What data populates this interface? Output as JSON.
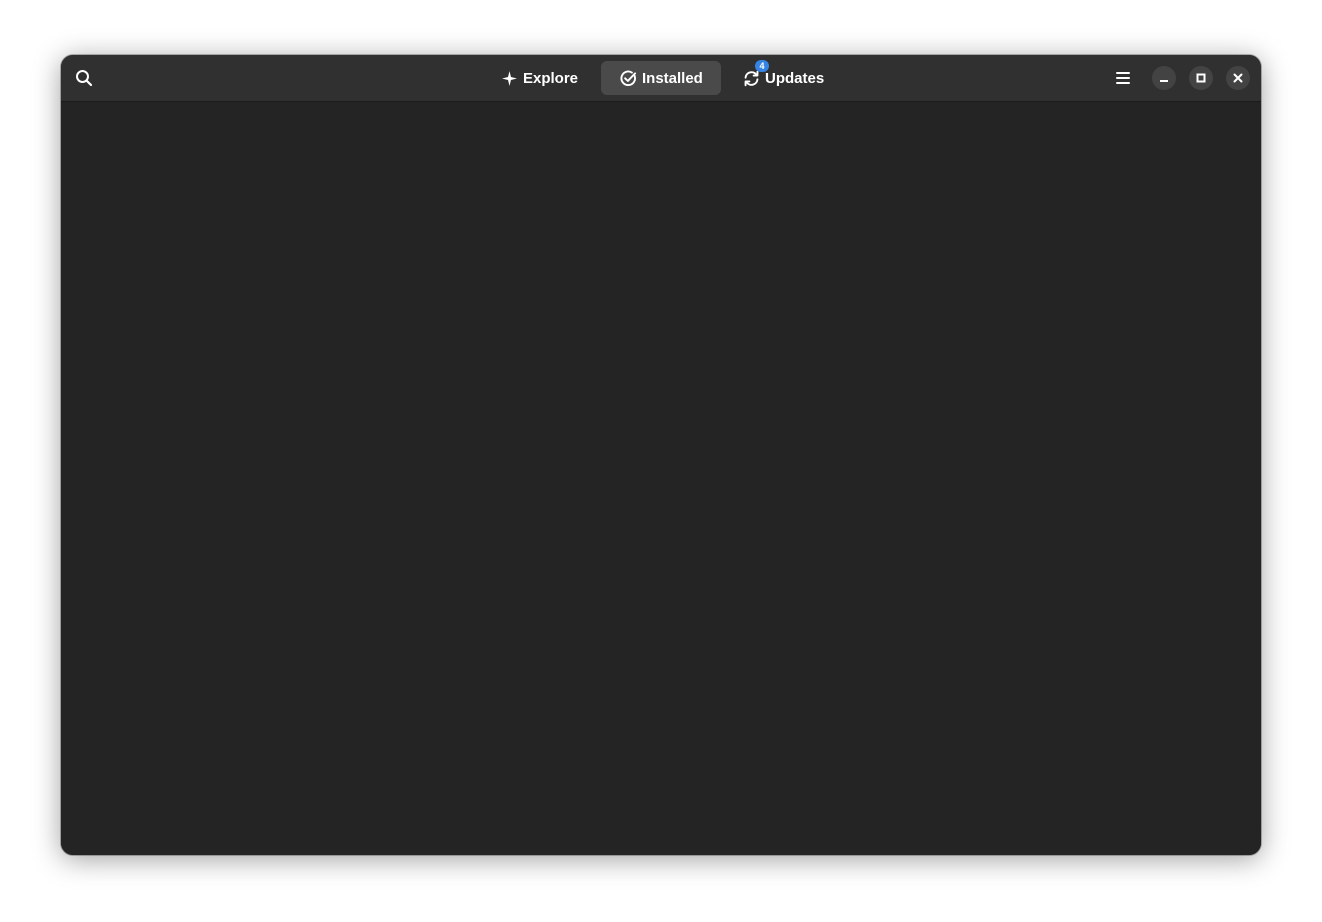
{
  "headerbar": {
    "tabs": [
      {
        "label": "Explore",
        "icon": "explore-icon"
      },
      {
        "label": "Installed",
        "icon": "check-circle-icon",
        "active": true
      },
      {
        "label": "Updates",
        "icon": "refresh-icon",
        "badge": "4"
      }
    ],
    "left_icon": "search-icon",
    "right_icons": [
      "hamburger-menu-icon",
      "minimize-icon",
      "maximize-icon",
      "close-icon"
    ]
  },
  "colors": {
    "window_bg": "#242424",
    "headerbar_bg": "#303030",
    "active_tab_bg": "#4a4a4a",
    "badge_bg": "#3584e4",
    "text": "#ffffff"
  }
}
